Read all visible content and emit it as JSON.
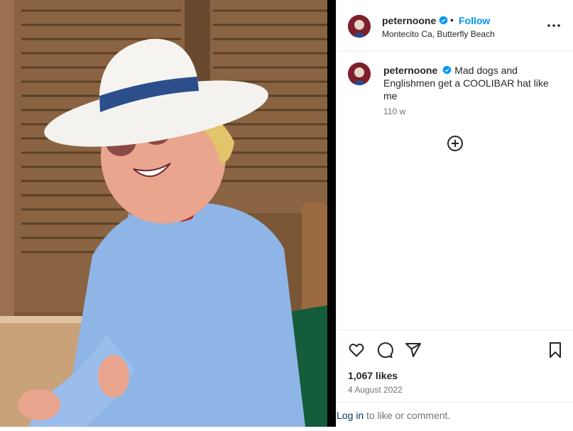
{
  "post": {
    "username": "peternoone",
    "location": "Montecito Ca, Butterfly Beach",
    "follow_label": "Follow",
    "dot": "•",
    "caption_text": "Mad dogs and Englishmen get a COOLIBAR hat like me",
    "time_ago": "110 w",
    "likes": "1,067 likes",
    "date": "4 August 2022"
  },
  "footer": {
    "login_label": "Log in",
    "rest_text": " to like or comment."
  },
  "colors": {
    "follow_blue": "#0095f6",
    "verified_blue": "#0095f6",
    "login_link": "#00376b"
  },
  "icons": [
    "verified-badge-icon",
    "more-options-icon",
    "add-circle-icon",
    "heart-icon",
    "comment-icon",
    "share-icon",
    "bookmark-icon"
  ]
}
